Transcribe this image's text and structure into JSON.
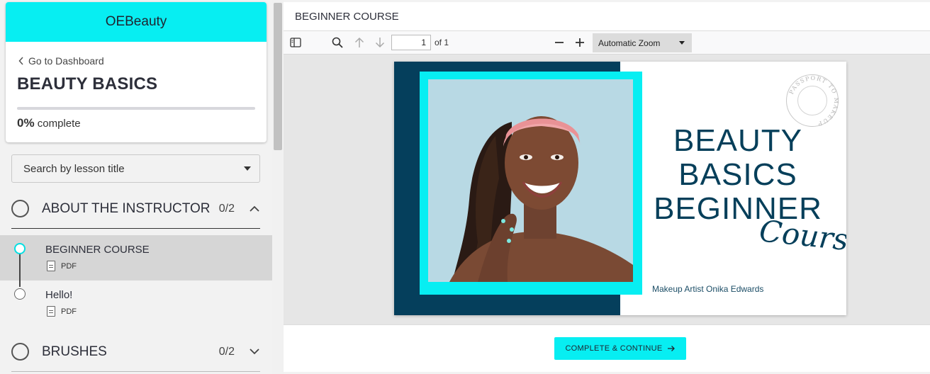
{
  "sidebar": {
    "brand": "OEBeauty",
    "back_link": "Go to Dashboard",
    "course_title": "BEAUTY BASICS",
    "progress": {
      "percent_label": "0%",
      "suffix": "complete",
      "fraction": 0
    },
    "search_placeholder": "Search by lesson title",
    "sections": [
      {
        "title": "ABOUT THE INSTRUCTOR",
        "count": "0/2",
        "expanded": true,
        "lessons": [
          {
            "title": "BEGINNER COURSE",
            "type": "PDF",
            "active": true
          },
          {
            "title": "Hello!",
            "type": "PDF",
            "active": false
          }
        ]
      },
      {
        "title": "BRUSHES",
        "count": "0/2",
        "expanded": false
      }
    ]
  },
  "main": {
    "lesson_title": "BEGINNER COURSE",
    "viewer": {
      "page_number": "1",
      "page_of": "of 1",
      "zoom": "Automatic Zoom"
    },
    "pdf": {
      "title_lines": [
        "BEAUTY",
        "BASICS",
        "BEGINNER"
      ],
      "script_word": "Course",
      "artist": "Makeup Artist Onika Edwards",
      "stamp_text": "PASSPORT TO MAKEUP"
    },
    "complete_button": "COMPLETE & CONTINUE"
  },
  "colors": {
    "accent": "#07eef2",
    "navy": "#053f5c"
  }
}
